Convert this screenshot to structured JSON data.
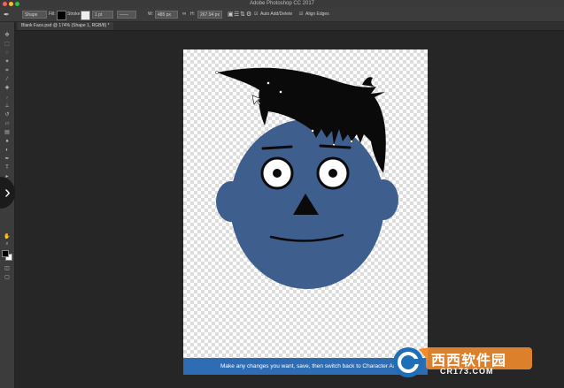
{
  "window": {
    "title": "Adobe Photoshop CC 2017"
  },
  "options_bar": {
    "mode": "Shape",
    "fill_label": "Fill:",
    "stroke_label": "Stroke:",
    "stroke_size": "1 pt",
    "w_label": "W:",
    "w_value": "485 px",
    "h_label": "H:",
    "h_value": "267.94 px",
    "auto_add_delete": "Auto Add/Delete",
    "align_edges": "Align Edges"
  },
  "document": {
    "tab_title": "Blank Face.psd @ 174% (Shape 1, RGB/8) *"
  },
  "canvas": {
    "caption": "Make any changes you want, save, then switch back to Character Animator"
  },
  "watermark": {
    "text": "西西软件园",
    "sub": "CR173.COM"
  },
  "colors": {
    "face": "#3e5e8e",
    "hair": "#0a0a0a",
    "caption_bar": "#2e6db4",
    "ui_dark": "#262626"
  }
}
